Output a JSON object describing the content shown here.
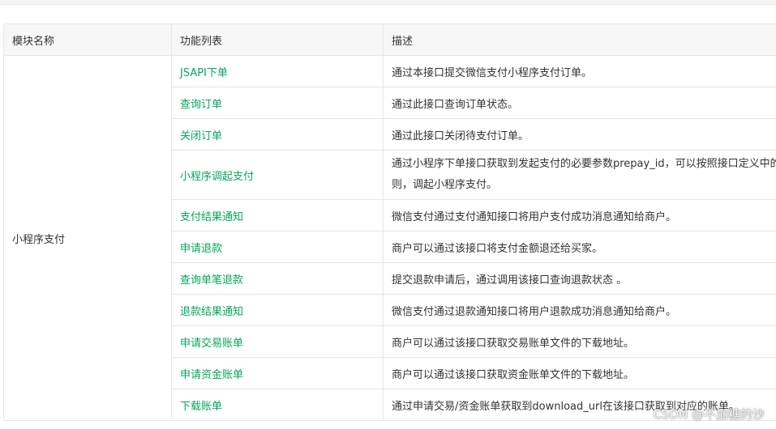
{
  "table": {
    "headers": {
      "module": "模块名称",
      "functions": "功能列表",
      "description": "描述"
    },
    "module_name": "小程序支付",
    "rows": [
      {
        "function": "JSAPI下单",
        "description": "通过本接口提交微信支付小程序支付订单。"
      },
      {
        "function": "查询订单",
        "description": "通过此接口查询订单状态。"
      },
      {
        "function": "关闭订单",
        "description": "通过此接口关闭待支付订单。"
      },
      {
        "function": "小程序调起支付",
        "description": "通过小程序下单接口获取到发起支付的必要参数prepay_id，可以按照接口定义中的规则，调起小程序支付。"
      },
      {
        "function": "支付结果通知",
        "description": "微信支付通过支付通知接口将用户支付成功消息通知给商户。"
      },
      {
        "function": "申请退款",
        "description": "商户可以通过该接口将支付金额退还给买家。"
      },
      {
        "function": "查询单笔退款",
        "description": "提交退款申请后，通过调用该接口查询退款状态 。"
      },
      {
        "function": "退款结果通知",
        "description": "微信支付通过退款通知接口将用户退款成功消息通知给商户。"
      },
      {
        "function": "申请交易账单",
        "description": "商户可以通过该接口获取交易账单文件的下载地址。"
      },
      {
        "function": "申请资金账单",
        "description": "商户可以通过该接口获取资金账单文件的下载地址。"
      },
      {
        "function": "下载账单",
        "description": "通过申请交易/资金账单获取到download_url在该接口获取到对应的账单。"
      }
    ]
  },
  "watermark": "CSDN @不加糖的沙"
}
